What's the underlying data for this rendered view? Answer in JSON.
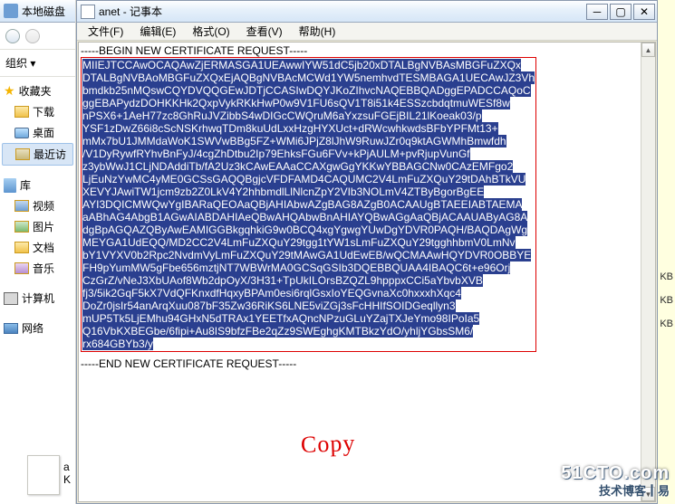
{
  "explorer": {
    "title": "本地磁盘",
    "organize": "组织 ▾",
    "fav": "收藏夹",
    "downloads": "下载",
    "desktop": "桌面",
    "recent": "最近访",
    "library": "库",
    "video": "视频",
    "pictures": "图片",
    "documents": "文档",
    "music": "音乐",
    "computer": "计算机",
    "network": "网络",
    "thumb_label": "a",
    "thumb_ext": "K"
  },
  "notepad": {
    "title": "anet - 记事本",
    "menu": {
      "file": "文件(F)",
      "edit": "编辑(E)",
      "format": "格式(O)",
      "view": "查看(V)",
      "help": "帮助(H)"
    },
    "begin": "-----BEGIN NEW CERTIFICATE REQUEST-----",
    "body": [
      "MIIEJTCCAwOCAQAwZjERMASGA1UEAwwIYW51dC5jb20xDTALBgNVBAsMBGFuZXQx",
      "DTALBgNVBAoMBGFuZXQxEjAQBgNVBAcMCWd1YW5nemhvdTESMBAGA1UECAwJZ3Vh",
      "bmdkb25nMQswCQYDVQQGEwJDTjCCASIwDQYJKoZIhvcNAQEBBQADggEPADCCAQoC",
      "ggEBAPydzDOHKKHk2QxpVykRKkHwP0w9V1FU6sQV1T8i51k4ESSzcbdqtmuWESf8w",
      "nPSX6+1AeH77zc8GhRuJVZibbS4wDIGcCWQruM6aYxzsuFGEjBIL21lKoeak03/p",
      "YSF1zDwZ66i8cScNSKrhwqTDm8kuUdLxxHzgHYXUct+dRWcwhkwdsBFbYPFMt13+",
      "mMx7bU1JMMdaWoK1SWVwBBg5FZ+WMi6JPjZ8lJhW9RuwJZr0q9ktAGWMhBmwfdh",
      "/V1DyRywfRYhvBnFyJ/4cgZhDtbu2Ip79EhksFGu6FVv+kPjAULM+pvRjupVunGf",
      "z3ybWwJ1CLjNDAddiTb/fA2Uz3kCAwEAAaCCAXgwGgYKKwYBBAGCNw0CAzEMFgo2",
      "LjEuNzYwMC4yME0GCSsGAQQBgjcVFDFAMD4CAQUMC2V4LmFuZXQuY29tDAhBTkVU",
      "XEVYJAwiTW1jcm9zb2Z0LkV4Y2hhbmdlLlNlcnZpY2VIb3NOLmV4ZTByBgorBgEE",
      "AYI3DQICMWQwYgIBARaQEOAaQBjAHIAbwAZgBAG8AZgB0ACAAUgBTAEEIABTAEMA",
      "aABhAG4AbgB1AGwAIABDAHIAeQBwAHQAbwBnAHIAYQBwAGgAaQBjACAAUAByAG8A",
      "dgBpAGQAZQByAwEAMIGGBkgqhkiG9w0BCQ4xgYgwgYUwDgYDVR0PAQH/BAQDAgWg",
      "MEYGA1UdEQQ/MD2CC2V4LmFuZXQuY29tgg1tYW1sLmFuZXQuY29tgghhbmV0LmNv",
      "bY1VYXV0b2Rpc2NvdmVyLmFuZXQuY29tMAwGA1UdEwEB/wQCMAAwHQYDVR0OBBYE",
      "FH9pYumMW5gFbe656mztjNT7WBWrMA0GCSqGSIb3DQEBBQUAA4IBAQC6t+e96Orj",
      "CzGrZ/vNeJ3XbUAof8Wb2dpOyX/3H31+TpUkILOrsBZQZL9hpppxCCi5aYbvbXVB",
      "fj3/5ik2GqF5kX7VdQFKnxdfHqxyBPAm0esi6rqlGsxIoYEQGvnaXc0hxxxhXqc4",
      "DoZr0jsIr54anArqXuu087bF35Zw36RiKS6LNE5viZGj3sFcHHIfSOIDGeqllyn3",
      "mUP5Tk5LjEMhu94GHxN5dTRAx1YEETfxAQncNPzuGLuYZajTXJeYmo98IPoIa5",
      "Q16VbKXBEGbe/6fipi+Au8IS9bfzFBe2qZz9SWEghgKMTBkzYdO/yhljYGbsSM6/",
      "rx684GBYb3/y"
    ],
    "end": "-----END NEW CERTIFICATE REQUEST-----"
  },
  "annotation": "Copy",
  "watermark": {
    "main": "51CTO.com",
    "sub": "技术博客┃易"
  },
  "kb": [
    "KB",
    "KB",
    "KB"
  ]
}
